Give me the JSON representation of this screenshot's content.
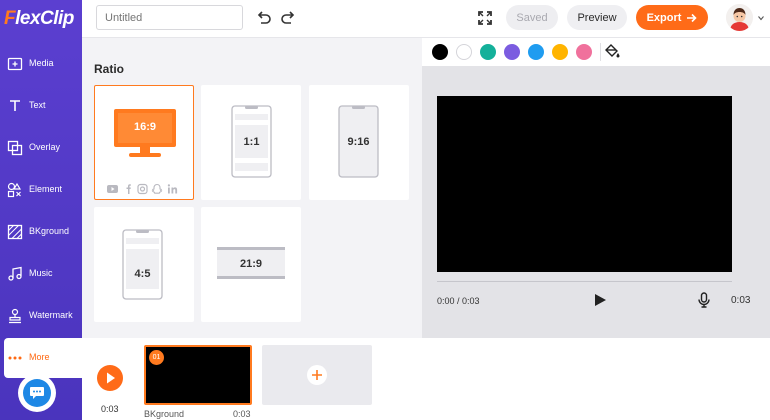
{
  "app": {
    "logo_first": "F",
    "logo_rest": "lexClip"
  },
  "sidebar": {
    "items": [
      {
        "label": "Media",
        "icon": "media-icon"
      },
      {
        "label": "Text",
        "icon": "text-icon"
      },
      {
        "label": "Overlay",
        "icon": "overlay-icon"
      },
      {
        "label": "Element",
        "icon": "element-icon"
      },
      {
        "label": "BKground",
        "icon": "background-icon"
      },
      {
        "label": "Music",
        "icon": "music-icon"
      },
      {
        "label": "Watermark",
        "icon": "watermark-icon"
      },
      {
        "label": "More",
        "icon": "more-icon",
        "active": true
      }
    ],
    "chat_icon": "chat-bubble-icon"
  },
  "topbar": {
    "title_placeholder": "Untitled",
    "saved_label": "Saved",
    "preview_label": "Preview",
    "export_label": "Export"
  },
  "ratio_panel": {
    "title": "Ratio",
    "options": [
      {
        "label": "16:9",
        "selected": true,
        "social_icons": [
          "youtube-icon",
          "facebook-icon",
          "instagram-icon",
          "snapchat-icon",
          "linkedin-icon"
        ]
      },
      {
        "label": "1:1"
      },
      {
        "label": "9:16"
      },
      {
        "label": "4:5"
      },
      {
        "label": "21:9"
      }
    ]
  },
  "colors": {
    "swatches": [
      "#000000",
      "#ffffff",
      "#14b09a",
      "#7b5ce0",
      "#1f9cf0",
      "#ffb400",
      "#f0719c"
    ],
    "accent": "#ff6b18",
    "sidebar": "#5b3fd0"
  },
  "preview": {
    "time_display": "0:00 / 0:03",
    "duration": "0:03"
  },
  "timeline": {
    "total_duration": "0:03",
    "clips": [
      {
        "badge": "01",
        "name": "BKground",
        "duration": "0:03"
      }
    ]
  }
}
